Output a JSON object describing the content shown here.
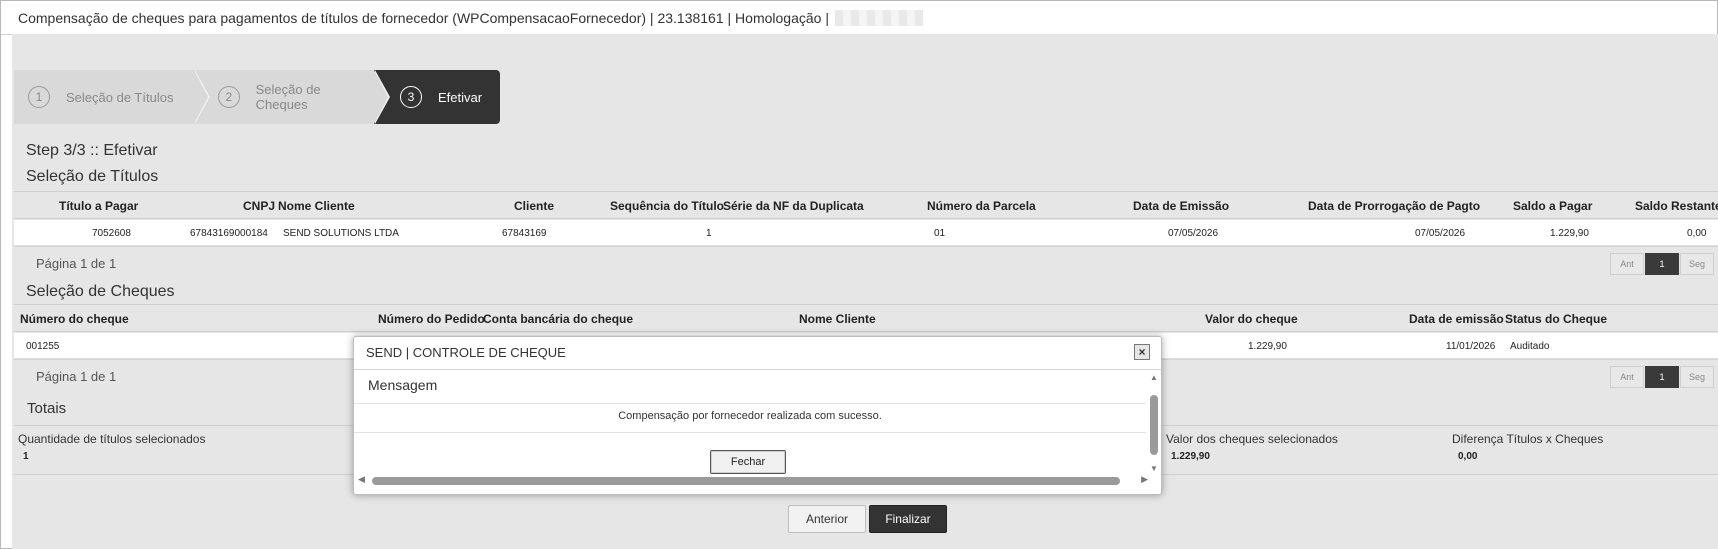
{
  "window": {
    "title": "Compensação de cheques para pagamentos de títulos de fornecedor (WPCompensacaoFornecedor) | 23.138161 | Homologação |"
  },
  "wizard": {
    "steps": [
      {
        "number": "1",
        "label": "Seleção de Títulos",
        "state": "inactive"
      },
      {
        "number": "2",
        "label": "Seleção de Cheques",
        "state": "inactive"
      },
      {
        "number": "3",
        "label": "Efetivar",
        "state": "active"
      }
    ]
  },
  "page": {
    "step_title": "Step 3/3 :: Efetivar"
  },
  "titulos": {
    "section_title": "Seleção de Títulos",
    "columns": [
      "Título a Pagar",
      "CNPJ",
      "Nome Cliente",
      "Cliente",
      "Sequência do Título",
      "Série da NF da Duplicata",
      "Número da Parcela",
      "Data de Emissão",
      "Data de Prorrogação de Pagto",
      "Saldo a Pagar",
      "Saldo Restante"
    ],
    "rows": [
      {
        "titulo": "7052608",
        "cnpj": "67843169000184",
        "nome": "SEND SOLUTIONS LTDA",
        "cliente": "67843169",
        "sequencia": "1",
        "serie": "",
        "parcela": "01",
        "emissao": "07/05/2026",
        "prorrogacao": "07/05/2026",
        "saldo_pagar": "1.229,90",
        "saldo_restante": "0,00"
      }
    ],
    "pager": {
      "text": "Página 1 de 1",
      "prev": "Ant",
      "page": "1",
      "next": "Seg"
    }
  },
  "cheques": {
    "section_title": "Seleção de Cheques",
    "columns": [
      "Número do cheque",
      "Número do Pedido",
      "Conta bancária do cheque",
      "Nome Cliente",
      "Valor do cheque",
      "Data de emissão",
      "Status do Cheque"
    ],
    "rows": [
      {
        "numero": "001255",
        "valor": "1.229,90",
        "emissao": "11/01/2026",
        "status": "Auditado"
      }
    ],
    "pager": {
      "text": "Página 1 de 1",
      "prev": "Ant",
      "page": "1",
      "next": "Seg"
    }
  },
  "totais": {
    "title": "Totais",
    "qtd_titulos_label": "Quantidade de títulos selecionados",
    "qtd_titulos_value": "1",
    "valor_cheques_label": "Valor dos cheques selecionados",
    "valor_cheques_value": "1.229,90",
    "diferenca_label": "Diferença Títulos x Cheques",
    "diferenca_value": "0,00"
  },
  "actions": {
    "anterior": "Anterior",
    "finalizar": "Finalizar"
  },
  "modal": {
    "title": "SEND | CONTROLE DE CHEQUE",
    "subtitle": "Mensagem",
    "message": "Compensação por fornecedor realizada com sucesso.",
    "button": "Fechar",
    "close_icon": "×"
  }
}
